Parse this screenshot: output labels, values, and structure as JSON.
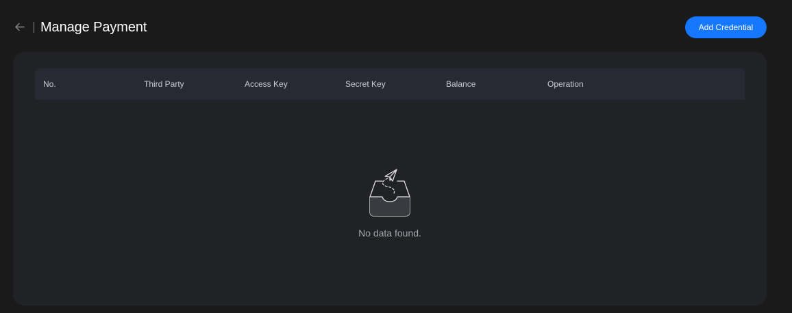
{
  "header": {
    "back_icon": "arrow-left-icon",
    "title": "Manage Payment",
    "add_label": "Add Credential"
  },
  "table": {
    "columns": [
      "No.",
      "Third Party",
      "Access Key",
      "Secret Key",
      "Balance",
      "Operation"
    ],
    "rows": []
  },
  "empty_state": {
    "icon": "empty-inbox-paper-plane-icon",
    "message": "No data found."
  },
  "colors": {
    "page_background": "#1a1a1a",
    "card_background": "#212226",
    "table_header_background": "#282a33",
    "accent": "#1677ff"
  }
}
